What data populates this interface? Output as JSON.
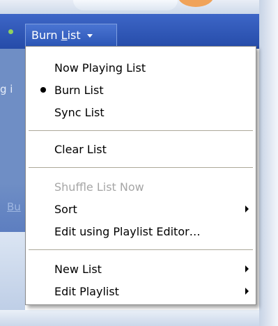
{
  "background": {
    "partial_text_1": "g i",
    "partial_text_2": "Bu"
  },
  "burn_button": {
    "label_prefix": "Burn ",
    "label_underlined": "L",
    "label_suffix": "ist",
    "icon": "chevron-down-icon"
  },
  "menu": {
    "items": [
      {
        "label": "Now Playing List",
        "checked": false,
        "enabled": true,
        "submenu": false
      },
      {
        "label": "Burn List",
        "checked": true,
        "enabled": true,
        "submenu": false
      },
      {
        "label": "Sync List",
        "checked": false,
        "enabled": true,
        "submenu": false
      },
      {
        "label": "Clear List",
        "checked": false,
        "enabled": true,
        "submenu": false
      },
      {
        "label": "Shuffle List Now",
        "checked": false,
        "enabled": false,
        "submenu": false
      },
      {
        "label": "Sort",
        "checked": false,
        "enabled": true,
        "submenu": true
      },
      {
        "label": "Edit using Playlist Editor…",
        "checked": false,
        "enabled": true,
        "submenu": false
      },
      {
        "label": "New List",
        "checked": false,
        "enabled": true,
        "submenu": true
      },
      {
        "label": "Edit Playlist",
        "checked": false,
        "enabled": true,
        "submenu": true
      }
    ]
  },
  "colors": {
    "accent": "#2c56b6",
    "disabled_text": "#a6a6a6",
    "separator": "#aca899"
  }
}
